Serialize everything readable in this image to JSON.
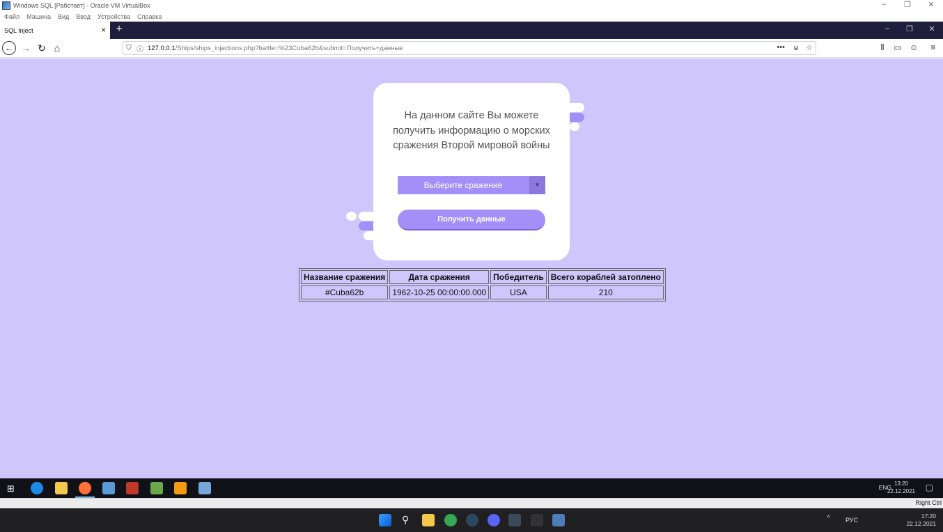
{
  "vbox": {
    "title": "Windows SQL [Работает] - Oracle VM VirtualBox",
    "menu": [
      "Файл",
      "Машина",
      "Вид",
      "Ввод",
      "Устройства",
      "Справка"
    ],
    "host_key": "Right Ctrl"
  },
  "browser": {
    "tab_title": "SQL Inject",
    "url_host": "127.0.0.1",
    "url_rest": "/Ships/ships_injections.php?battle=%23Cuba62b&submit=Получить+данные"
  },
  "page": {
    "intro": "На данном сайте Вы можете получить информацию о морских сражения Второй мировой войны",
    "select_placeholder": "Выберите сражение",
    "submit_label": "Получить данные",
    "table": {
      "headers": [
        "Название сражения",
        "Дата сражения",
        "Победитель",
        "Всего кораблей затоплено"
      ],
      "rows": [
        [
          "#Cuba62b",
          "1962-10-25 00:00:00.000",
          "USA",
          "210"
        ]
      ]
    }
  },
  "guest_taskbar": {
    "lang": "ENG",
    "time": "13:20",
    "date": "22.12.2021"
  },
  "host_taskbar": {
    "lang": "РУС",
    "time": "17:20",
    "date": "22.12.2021"
  },
  "colors": {
    "page_bg": "#cfc6fb",
    "accent": "#a28ff7"
  }
}
